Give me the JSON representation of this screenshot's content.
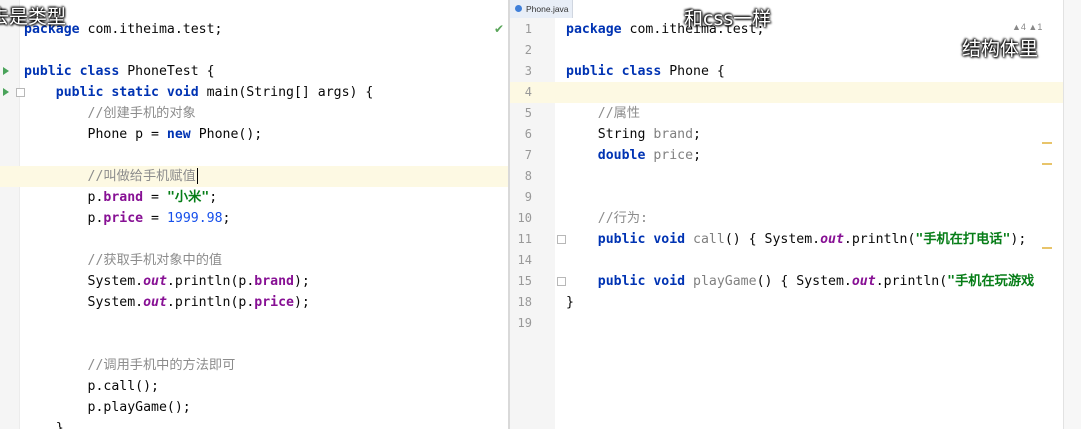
{
  "left_editor": {
    "lines": [
      {
        "tokens": [
          {
            "t": "package",
            "c": "kw"
          },
          {
            "t": " com.itheima.test;"
          }
        ]
      },
      {
        "tokens": []
      },
      {
        "tokens": [
          {
            "t": "public class",
            "c": "kw"
          },
          {
            "t": " PhoneTest {"
          }
        ]
      },
      {
        "tokens": [
          {
            "t": "    public static void",
            "c": "kw"
          },
          {
            "t": " main(String[] args) {"
          }
        ]
      },
      {
        "tokens": [
          {
            "t": "        //创建手机的对象",
            "c": "cm"
          }
        ]
      },
      {
        "tokens": [
          {
            "t": "        Phone p = "
          },
          {
            "t": "new",
            "c": "kw"
          },
          {
            "t": " Phone();"
          }
        ]
      },
      {
        "tokens": []
      },
      {
        "tokens": [
          {
            "t": "        //叫做给手机赋值",
            "c": "cm"
          }
        ],
        "current": true,
        "caret": true
      },
      {
        "tokens": [
          {
            "t": "        p."
          },
          {
            "t": "brand",
            "c": "fd"
          },
          {
            "t": " = "
          },
          {
            "t": "\"小米\"",
            "c": "st"
          },
          {
            "t": ";"
          }
        ]
      },
      {
        "tokens": [
          {
            "t": "        p."
          },
          {
            "t": "price",
            "c": "fd"
          },
          {
            "t": " = "
          },
          {
            "t": "1999.98",
            "c": "nm"
          },
          {
            "t": ";"
          }
        ]
      },
      {
        "tokens": []
      },
      {
        "tokens": [
          {
            "t": "        //获取手机对象中的值",
            "c": "cm"
          }
        ]
      },
      {
        "tokens": [
          {
            "t": "        System."
          },
          {
            "t": "out",
            "c": "it"
          },
          {
            "t": ".println(p."
          },
          {
            "t": "brand",
            "c": "fd"
          },
          {
            "t": ");"
          }
        ]
      },
      {
        "tokens": [
          {
            "t": "        System."
          },
          {
            "t": "out",
            "c": "it"
          },
          {
            "t": ".println(p."
          },
          {
            "t": "price",
            "c": "fd"
          },
          {
            "t": ");"
          }
        ]
      },
      {
        "tokens": []
      },
      {
        "tokens": []
      },
      {
        "tokens": [
          {
            "t": "        //调用手机中的方法即可",
            "c": "cm"
          }
        ]
      },
      {
        "tokens": [
          {
            "t": "        p.call();"
          }
        ]
      },
      {
        "tokens": [
          {
            "t": "        p.playGame();"
          }
        ]
      },
      {
        "tokens": [
          {
            "t": "    }"
          }
        ]
      }
    ]
  },
  "right_editor": {
    "tab_label": "Phone.java",
    "warning_count": "▲4 ▲1",
    "lines": [
      {
        "n": "1",
        "tokens": [
          {
            "t": "package",
            "c": "kw"
          },
          {
            "t": " com.itheima.test;"
          }
        ]
      },
      {
        "n": "2",
        "tokens": []
      },
      {
        "n": "3",
        "tokens": [
          {
            "t": "public class",
            "c": "kw"
          },
          {
            "t": " Phone {"
          }
        ]
      },
      {
        "n": "4",
        "tokens": [],
        "current": true
      },
      {
        "n": "5",
        "tokens": [
          {
            "t": "    //属性",
            "c": "cm"
          }
        ]
      },
      {
        "n": "6",
        "tokens": [
          {
            "t": "    String "
          },
          {
            "t": "brand",
            "c": "gr"
          },
          {
            "t": ";"
          }
        ]
      },
      {
        "n": "7",
        "tokens": [
          {
            "t": "    double",
            "c": "kw"
          },
          {
            "t": " "
          },
          {
            "t": "price",
            "c": "gr"
          },
          {
            "t": ";"
          }
        ]
      },
      {
        "n": "8",
        "tokens": []
      },
      {
        "n": "9",
        "tokens": []
      },
      {
        "n": "10",
        "tokens": [
          {
            "t": "    //行为:",
            "c": "cm"
          }
        ]
      },
      {
        "n": "11",
        "tokens": [
          {
            "t": "    public void",
            "c": "kw"
          },
          {
            "t": " "
          },
          {
            "t": "call",
            "c": "gr"
          },
          {
            "t": "() { System."
          },
          {
            "t": "out",
            "c": "it"
          },
          {
            "t": ".println("
          },
          {
            "t": "\"手机在打电话\"",
            "c": "st"
          },
          {
            "t": ");"
          }
        ]
      },
      {
        "n": "14",
        "tokens": []
      },
      {
        "n": "15",
        "tokens": [
          {
            "t": "    public void",
            "c": "kw"
          },
          {
            "t": " "
          },
          {
            "t": "playGame",
            "c": "gr"
          },
          {
            "t": "() { System."
          },
          {
            "t": "out",
            "c": "it"
          },
          {
            "t": ".println("
          },
          {
            "t": "\"手机在玩游戏",
            "c": "st"
          }
        ]
      },
      {
        "n": "18",
        "tokens": [
          {
            "t": "}"
          }
        ]
      },
      {
        "n": "19",
        "tokens": []
      }
    ]
  },
  "overlays": {
    "left_top": "去是类型",
    "middle_top": "和css一样",
    "right_top": "结构体里"
  }
}
